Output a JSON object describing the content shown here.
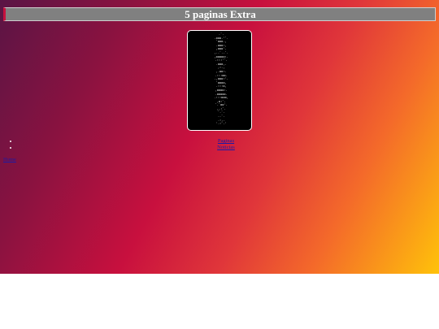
{
  "header": {
    "title": "5 paginas Extra"
  },
  "ascii_art": "  .`.\n  .ooo.'`.\n  `ooo.,\n  .ooo:,\n  ,ooo'.\n  ,..`..`.\n  ,ooooo:.\n  .:::'`.\n  .ooo,.\n  ,:.,\n  ,.oo:.\n  .:::oo.\n  .,ooo:'.\n  `oooo,\n  .:::o,\n  ,oooo:.\n  .ooooo.\n  .:::ooo,\n  ,o:`.\n  `.`oo'.\n  ,,:`.\n  `.`.\n  ..`.\n  .:,.\n  '.:`.'",
  "nav": {
    "items": [
      {
        "label": "Paginas"
      },
      {
        "label": "Noticias"
      }
    ]
  },
  "footer": {
    "home_label": "Home"
  }
}
